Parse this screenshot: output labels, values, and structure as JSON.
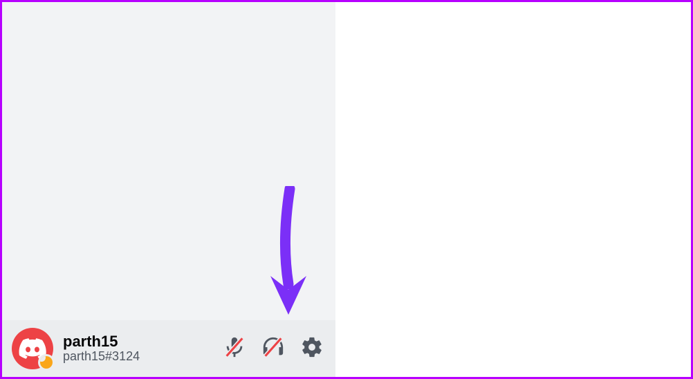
{
  "colors": {
    "frame_border": "#b700ff",
    "sidebar_bg": "#f2f3f5",
    "panel_bg": "#ebedef",
    "icon_fill": "#4f5660",
    "avatar_bg": "#ed4245",
    "status_idle": "#faa61a",
    "muted_slash": "#ed4245",
    "annotation": "#7b2ff7"
  },
  "user": {
    "name": "parth15",
    "tag": "parth15#3124",
    "status": "idle"
  },
  "icons": {
    "avatar": "discord-logo-icon",
    "status": "idle-moon-icon",
    "mute": "microphone-muted-icon",
    "deafen": "headphones-muted-icon",
    "settings": "gear-icon"
  },
  "annotation": {
    "type": "arrow",
    "target": "settings-button"
  }
}
